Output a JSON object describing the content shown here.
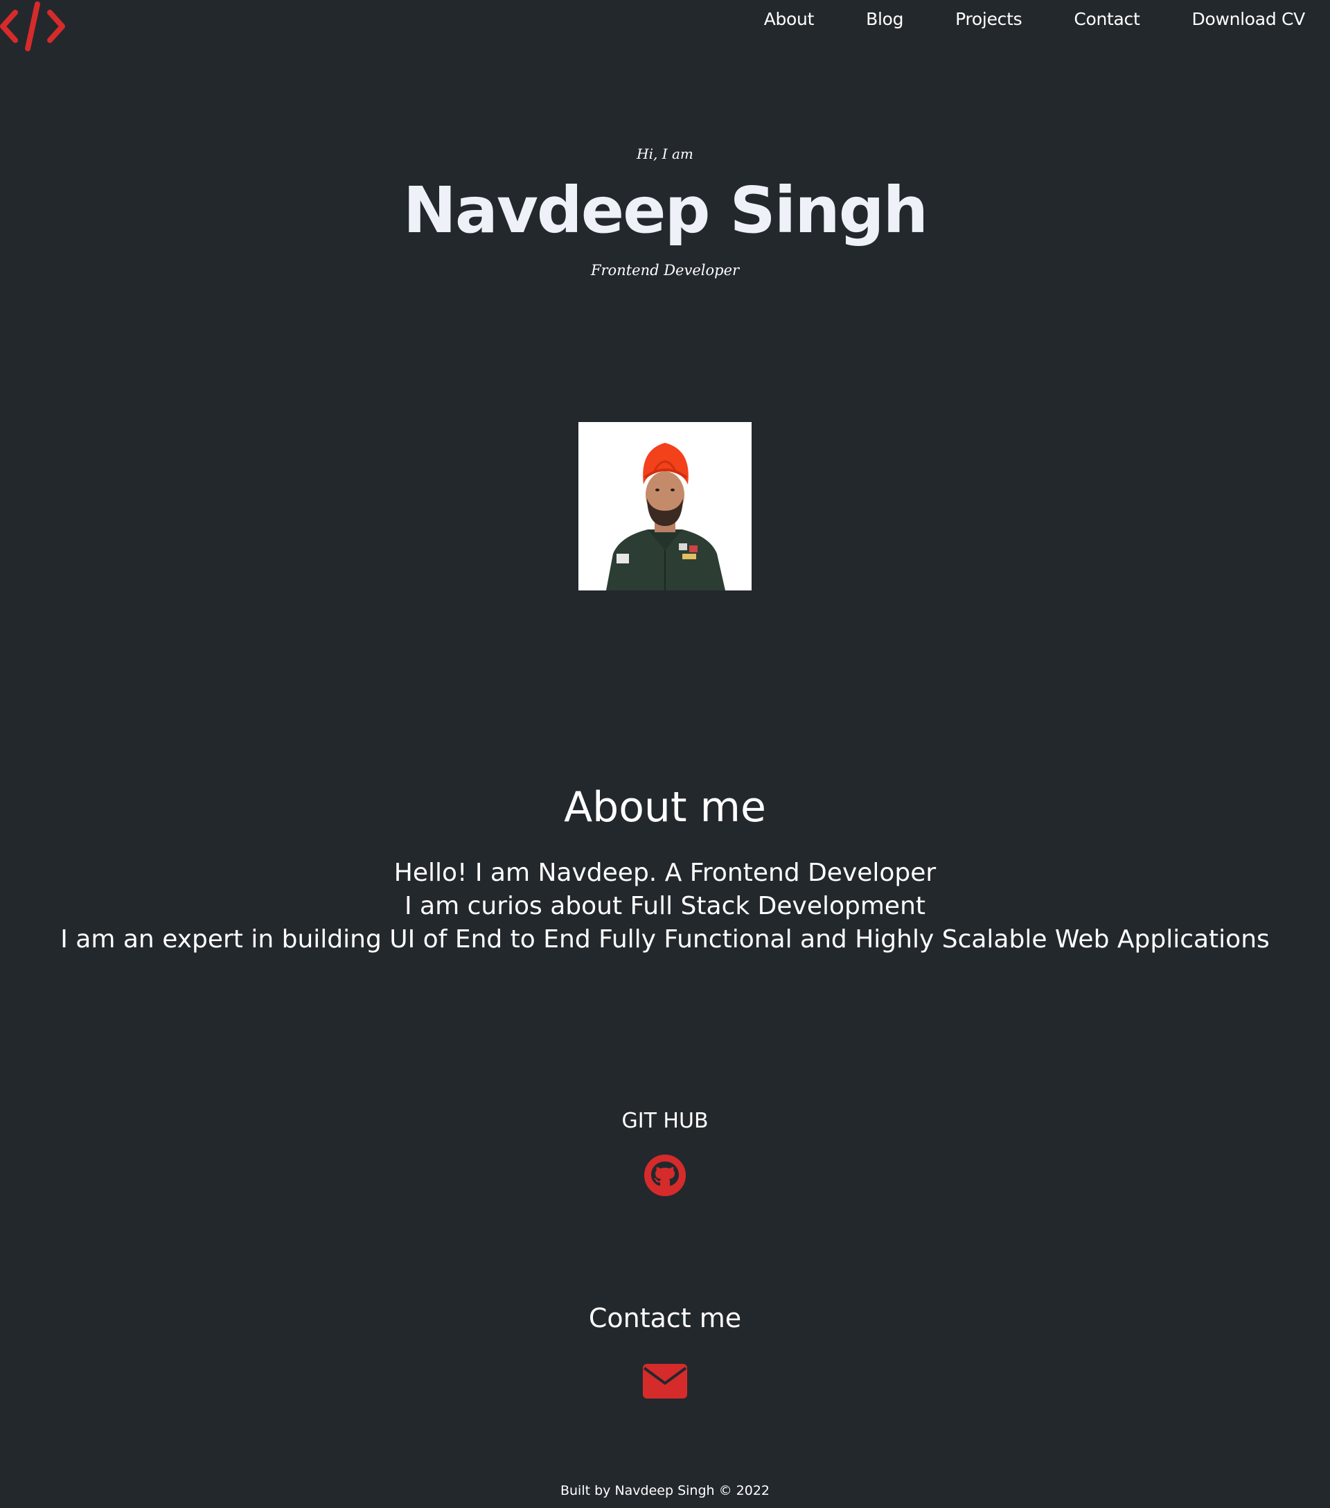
{
  "header": {
    "logo_icon": "code-brackets-icon",
    "nav": [
      {
        "label": "About"
      },
      {
        "label": "Blog"
      },
      {
        "label": "Projects"
      },
      {
        "label": "Contact"
      },
      {
        "label": "Download CV"
      }
    ]
  },
  "hero": {
    "greeting": "Hi, I am",
    "name": "Navdeep Singh",
    "role": "Frontend Developer"
  },
  "avatar": {
    "icon": "profile-photo"
  },
  "about": {
    "title": "About me",
    "lines": [
      "Hello! I am Navdeep. A Frontend Developer",
      "I am curios about Full Stack Development",
      "I am an expert in building UI of End to End Fully Functional and Highly Scalable Web Applications"
    ]
  },
  "github": {
    "title": "GIT HUB",
    "icon": "github-icon"
  },
  "contact": {
    "title": "Contact me",
    "icon": "mail-icon"
  },
  "footer": {
    "text": "Built by Navdeep Singh © 2022"
  },
  "colors": {
    "background": "#23282d",
    "accent": "#d62b2b",
    "text": "#ffffff"
  }
}
